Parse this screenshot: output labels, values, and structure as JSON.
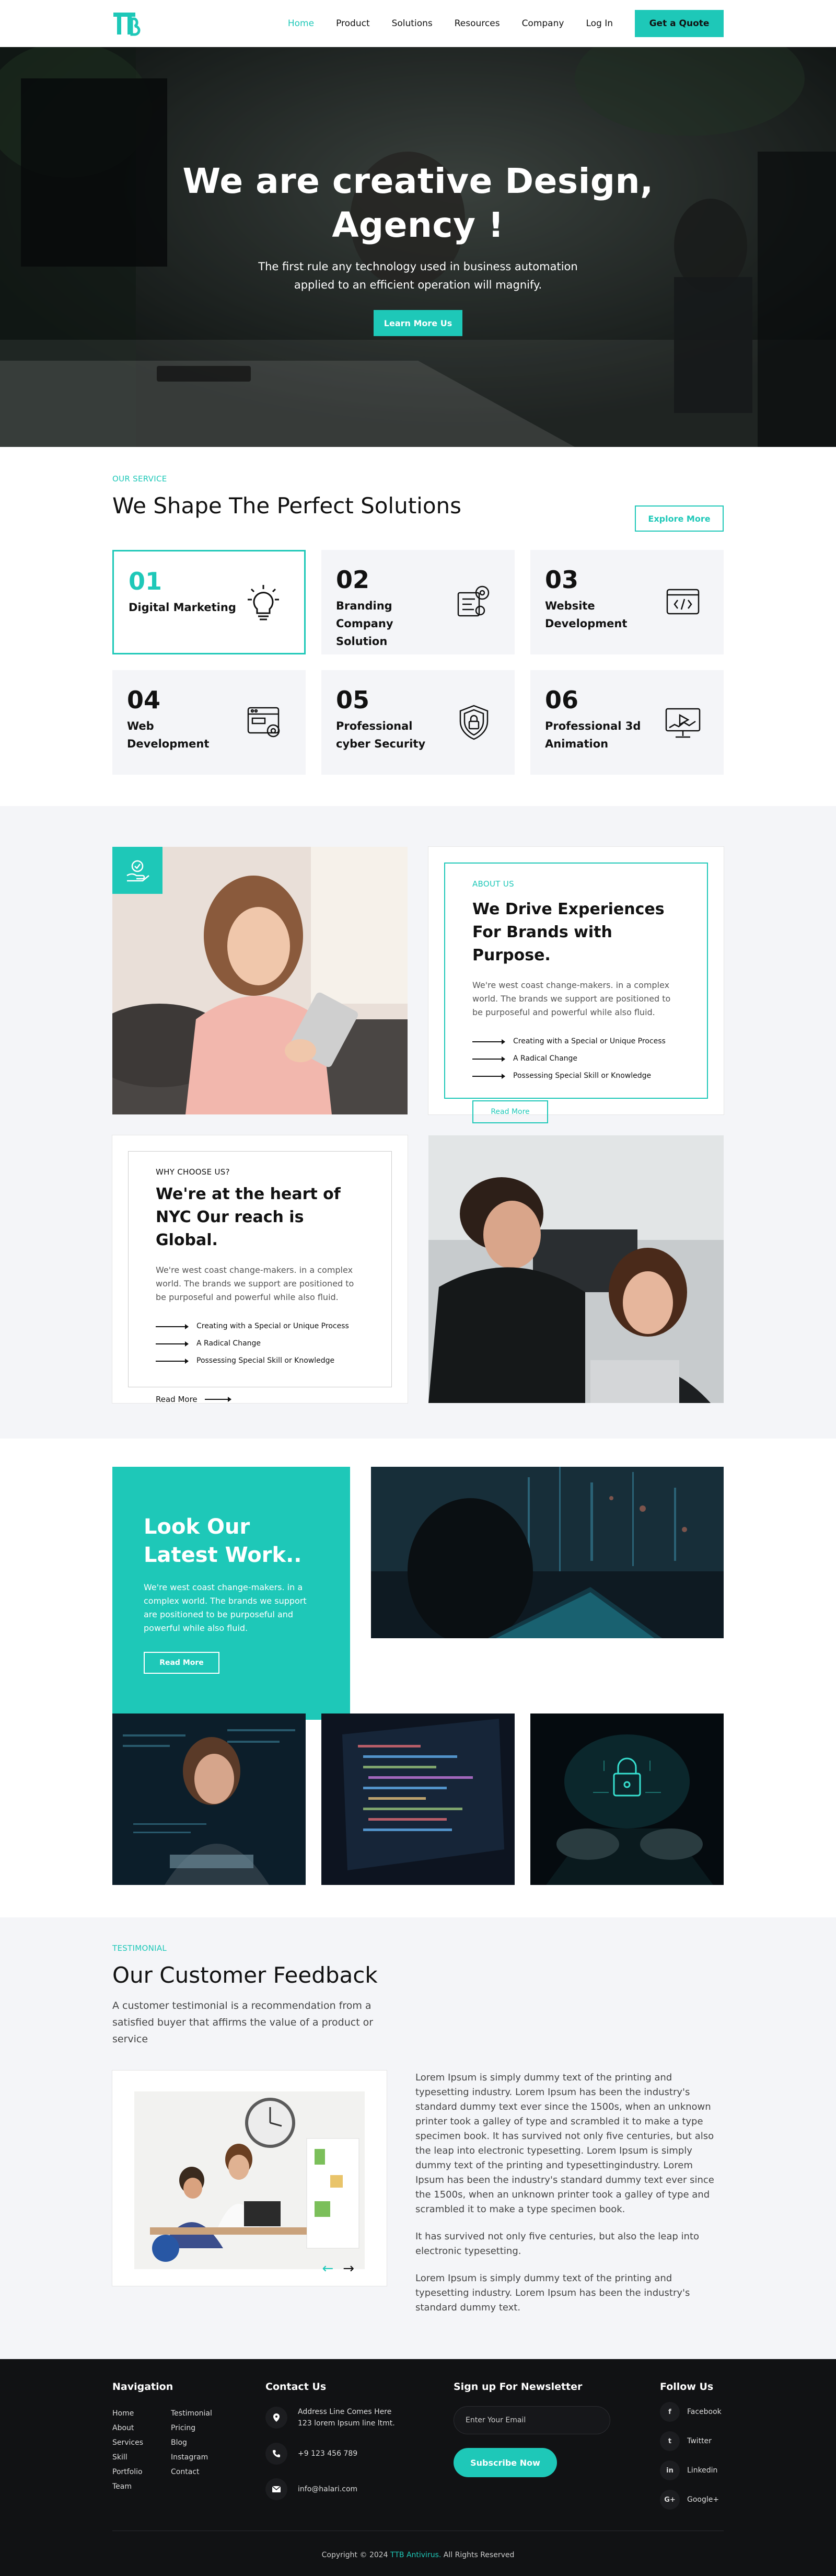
{
  "header": {
    "nav": [
      "Home",
      "Product",
      "Solutions",
      "Resources",
      "Company",
      "Log In"
    ],
    "quote": "Get a Quote"
  },
  "hero": {
    "title_line1": "We are creative Design,",
    "title_line2": "Agency !",
    "sub_line1": "The first rule any technology used in business automation",
    "sub_line2": "applied to an efficient operation will magnify.",
    "cta": "Learn More Us"
  },
  "services": {
    "eyebrow": "OUR SERVICE",
    "title": "We Shape The Perfect Solutions",
    "explore": "Explore More",
    "items": [
      {
        "num": "01",
        "name": "Digital Marketing",
        "icon": "lightbulb-icon"
      },
      {
        "num": "02",
        "name": "Branding Company Solution",
        "icon": "branding-icon"
      },
      {
        "num": "03",
        "name": "Website Development",
        "icon": "code-window-icon"
      },
      {
        "num": "04",
        "name": "Web Development",
        "icon": "web-settings-icon"
      },
      {
        "num": "05",
        "name": "Professional cyber Security",
        "icon": "shield-lock-icon"
      },
      {
        "num": "06",
        "name": "Professional 3d Animation",
        "icon": "monitor-play-icon"
      }
    ]
  },
  "about": {
    "eyebrow": "ABOUT US",
    "title": "We Drive Experiences For Brands with Purpose.",
    "desc": "We're west coast change-makers. in a complex world. The brands we support are positioned to be purposeful and powerful while also fluid.",
    "points": [
      "Creating with a Special or Unique Process",
      "A Radical Change",
      "Possessing Special Skill or Knowledge"
    ],
    "read_more": "Read More"
  },
  "why": {
    "eyebrow": "WHY CHOOSE US?",
    "title": "We're at the heart of NYC Our reach is Global.",
    "desc": "We're west coast change-makers. in a complex world. The brands we support are positioned to be purposeful and powerful while also fluid.",
    "points": [
      "Creating with a Special or Unique Process",
      "A Radical Change",
      "Possessing Special Skill or Knowledge"
    ],
    "read_more": "Read More"
  },
  "work": {
    "title": "Look Our Latest Work..",
    "desc": "We're west coast change-makers. in a complex world. The brands we support are positioned to be purposeful and powerful while also fluid.",
    "read_more": "Read More"
  },
  "testimonial": {
    "eyebrow": "TESTIMONIAL",
    "title": "Our Customer Feedback",
    "sub": "A customer testimonial is a recommendation from a satisfied buyer that affirms the value of a product or service",
    "p1": "Lorem Ipsum is simply dummy text of the printing and typesetting industry. Lorem Ipsum has been the industry's standard dummy text ever since the 1500s, when an unknown printer took a galley of type and scrambled it to make a type specimen book. It has survived not only five centuries, but also the leap into electronic typesetting. Lorem Ipsum is simply dummy text of the printing and typesettingindustry. Lorem Ipsum has been the industry's standard dummy text ever since the 1500s, when an unknown printer took a galley of type and scrambled it to make a type specimen book.",
    "p2": "It has survived not only five centuries, but also the leap into electronic typesetting.",
    "p3": "Lorem Ipsum is simply dummy text of the printing and typesetting industry. Lorem Ipsum has been the industry's standard dummy text.",
    "prev": "←",
    "next": "→"
  },
  "footer": {
    "nav_title": "Navigation",
    "links_col1": [
      "Home",
      "About",
      "Services",
      "Skill",
      "Portfolio",
      "Team"
    ],
    "links_col2": [
      "Testimonial",
      "Pricing",
      "Blog",
      "Instagram",
      "Contact"
    ],
    "contact_title": "Contact Us",
    "address": "Address Line Comes Here 123 lorem Ipsum line ltmt.",
    "phone": "+9 123 456 789",
    "email": "info@halari.com",
    "newsletter_title": "Sign up For Newsletter",
    "email_placeholder": "Enter Your Email",
    "subscribe": "Subscribe Now",
    "follow_title": "Follow Us",
    "social": [
      {
        "letter": "f",
        "name": "Facebook"
      },
      {
        "letter": "t",
        "name": "Twitter"
      },
      {
        "letter": "in",
        "name": "Linkedin"
      },
      {
        "letter": "G+",
        "name": "Google+"
      }
    ],
    "copy_pre": "Copyright © 2024",
    "copy_brand": "TTB Antivirus.",
    "copy_post": "All Rights Reserved"
  },
  "colors": {
    "accent": "#1ec8b8",
    "dark": "#111214",
    "light": "#f4f5f8"
  }
}
